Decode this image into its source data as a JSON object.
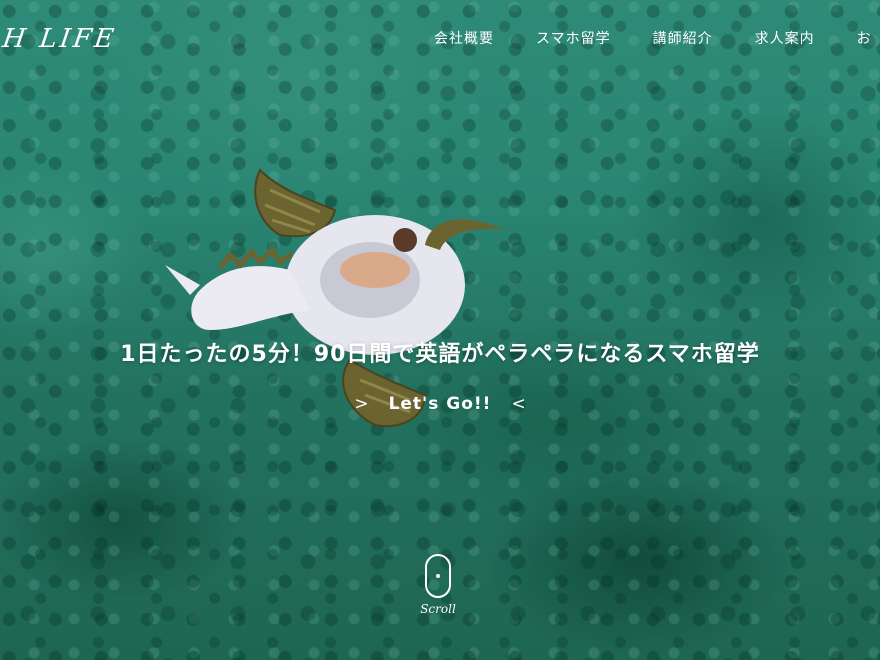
{
  "logo": {
    "text": "SH LIFE"
  },
  "nav": {
    "items": [
      {
        "label": "会社概要"
      },
      {
        "label": "スマホ留学"
      },
      {
        "label": "講師紹介"
      },
      {
        "label": "求人案内"
      },
      {
        "label": "お"
      }
    ]
  },
  "hero": {
    "headline": "1日たったの5分！90日間で英語がペラペラになるスマホ留学",
    "cta": {
      "left_chevron": ">",
      "label": "Let's Go!!",
      "right_chevron": "<"
    },
    "scroll_label": "Scroll"
  },
  "colors": {
    "water": "#2a8573",
    "text": "#ffffff",
    "float_body": "#e6e6ee",
    "float_gold": "#6b6330"
  }
}
